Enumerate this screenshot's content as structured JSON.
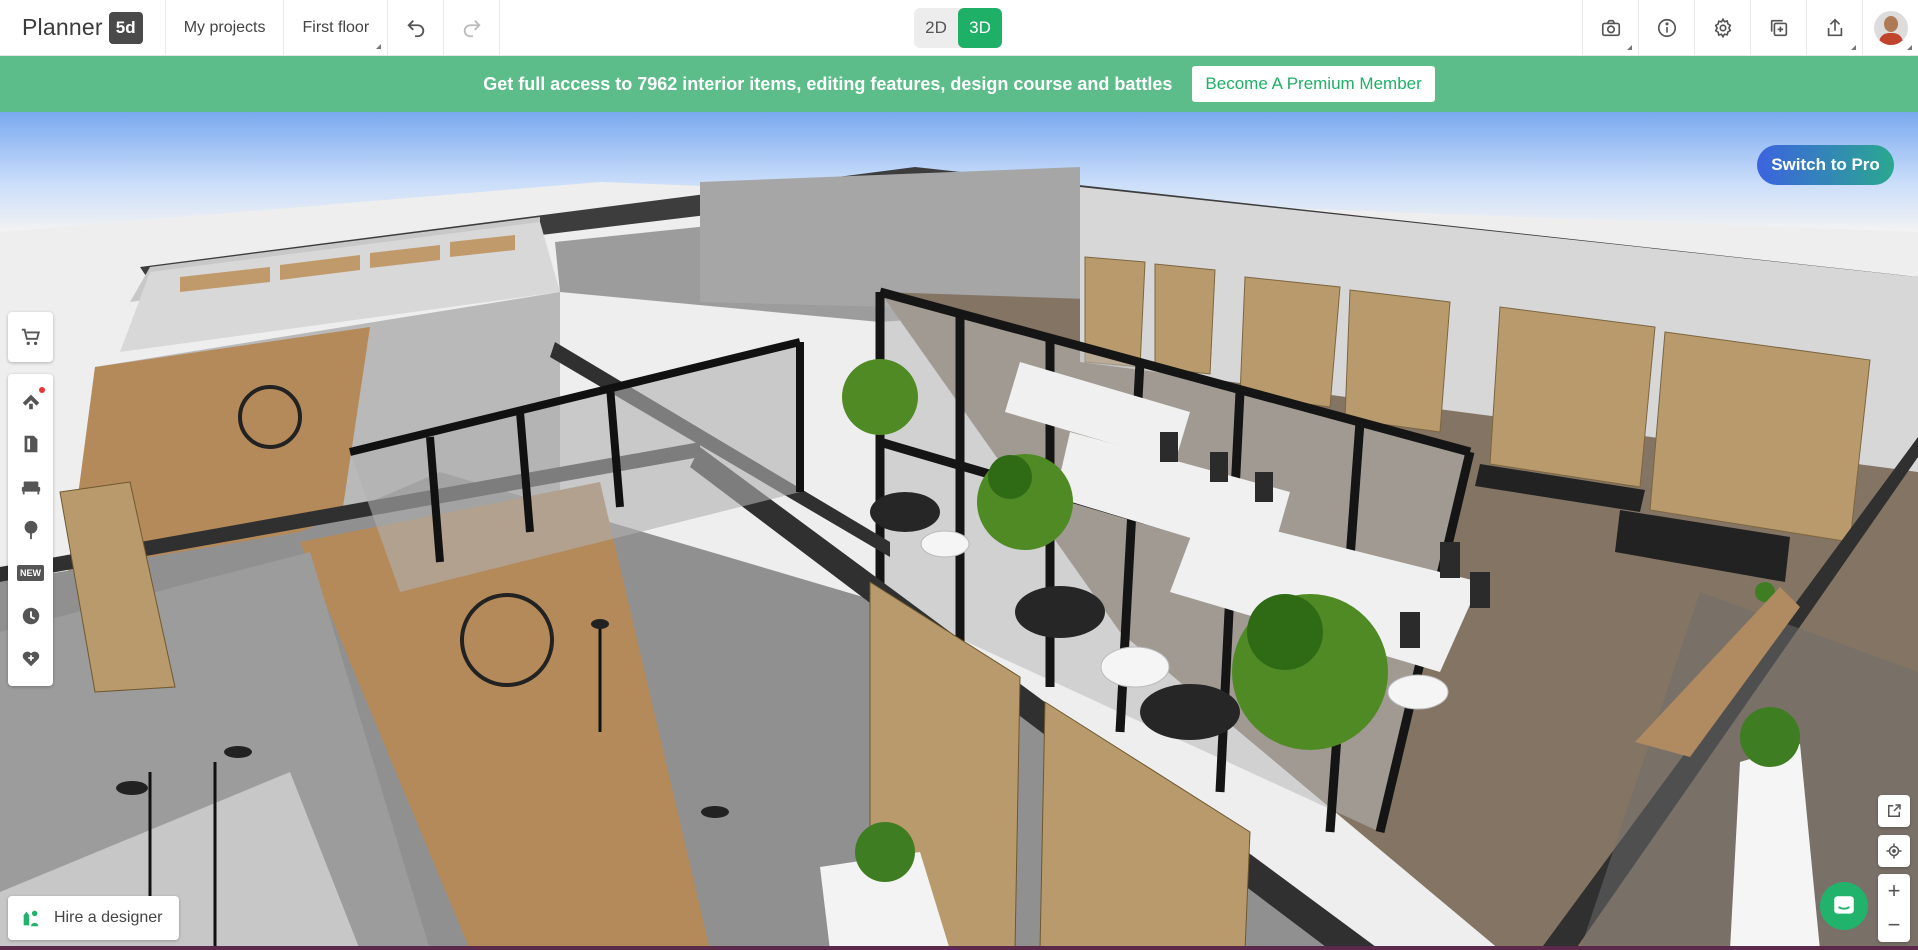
{
  "app": {
    "logo_text": "Planner",
    "logo_badge": "5d"
  },
  "topbar": {
    "my_projects": "My projects",
    "floor": "First floor",
    "view_2d": "2D",
    "view_3d": "3D",
    "active_view": "3D"
  },
  "banner": {
    "text": "Get full access to 7962 interior items, editing features, design course and battles",
    "button": "Become A Premium Member"
  },
  "switch_pro": "Switch to Pro",
  "left_toolbar": {
    "new_badge": "NEW"
  },
  "hire": "Hire a designer",
  "zoom": {
    "plus": "+",
    "minus": "−"
  },
  "colors": {
    "brand_green": "#1eb067",
    "banner_green": "#5dbd8a",
    "pro_gradient_start": "#3c63e0",
    "pro_gradient_end": "#2aa88f"
  },
  "icons": [
    "undo-icon",
    "redo-icon",
    "camera-icon",
    "info-icon",
    "gear-icon",
    "add-copy-icon",
    "share-icon",
    "cart-icon",
    "construction-icon",
    "book-icon",
    "sofa-icon",
    "tree-icon",
    "history-icon",
    "heart-icon",
    "expand-icon",
    "locate-icon",
    "chat-icon"
  ]
}
